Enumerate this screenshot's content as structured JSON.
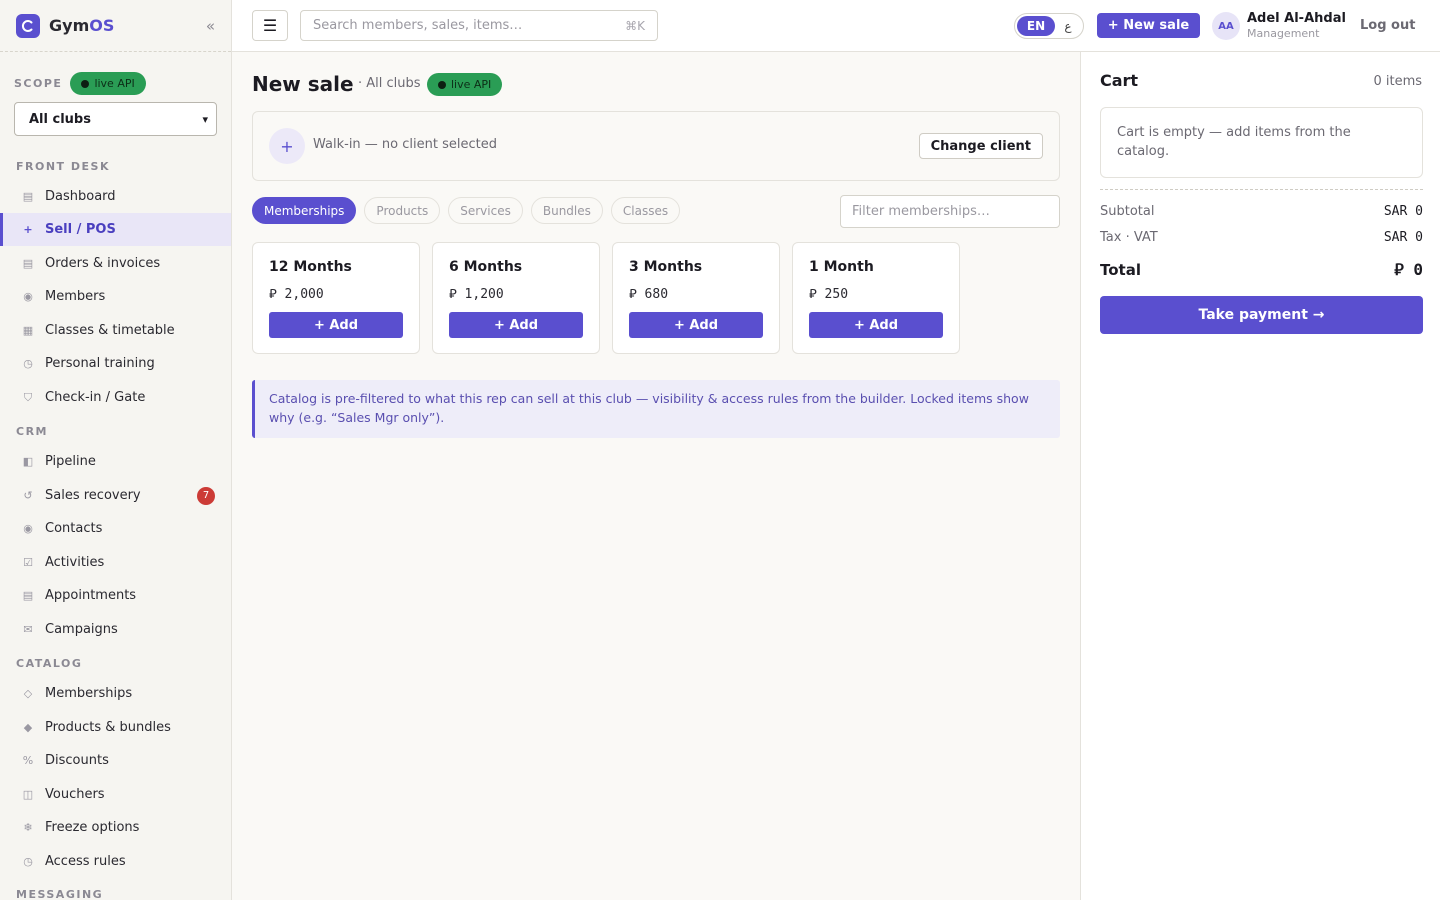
{
  "brand": {
    "name_main": "Gym",
    "name_accent": "OS",
    "collapse_icon": "«"
  },
  "scope": {
    "label": "SCOPE",
    "live_label": "live API",
    "club_selected": "All clubs"
  },
  "sidebar": {
    "sections": [
      {
        "label": "FRONT DESK",
        "items": [
          {
            "label": "Dashboard",
            "icon": "▤"
          },
          {
            "label": "Sell / POS",
            "icon": "+",
            "active": true
          },
          {
            "label": "Orders & invoices",
            "icon": "▤"
          },
          {
            "label": "Members",
            "icon": "◉"
          },
          {
            "label": "Classes & timetable",
            "icon": "▦"
          },
          {
            "label": "Personal training",
            "icon": "◷"
          },
          {
            "label": "Check-in / Gate",
            "icon": "⛉"
          }
        ]
      },
      {
        "label": "CRM",
        "items": [
          {
            "label": "Pipeline",
            "icon": "◧"
          },
          {
            "label": "Sales recovery",
            "icon": "↺",
            "badge": "7"
          },
          {
            "label": "Contacts",
            "icon": "◉"
          },
          {
            "label": "Activities",
            "icon": "☑"
          },
          {
            "label": "Appointments",
            "icon": "▤"
          },
          {
            "label": "Campaigns",
            "icon": "✉"
          }
        ]
      },
      {
        "label": "CATALOG",
        "items": [
          {
            "label": "Memberships",
            "icon": "◇"
          },
          {
            "label": "Products & bundles",
            "icon": "◆"
          },
          {
            "label": "Discounts",
            "icon": "%"
          },
          {
            "label": "Vouchers",
            "icon": "◫"
          },
          {
            "label": "Freeze options",
            "icon": "❄"
          },
          {
            "label": "Access rules",
            "icon": "◷"
          }
        ]
      },
      {
        "label": "MESSAGING",
        "items": []
      }
    ]
  },
  "topbar": {
    "menu_icon": "☰",
    "search_placeholder": "Search members, sales, items…",
    "search_shortcut": "⌘K",
    "lang_active": "EN",
    "lang_other": "ع",
    "new_sale_label": "+ New sale",
    "user_initials": "AA",
    "user_name": "Adel Al-Ahdal",
    "user_role": "Management",
    "logout_label": "Log out"
  },
  "main": {
    "title": "New sale",
    "subtitle": "· All clubs",
    "live_label": "live API",
    "client": {
      "plus": "+",
      "text": "Walk-in — no client selected",
      "change_label": "Change client"
    },
    "tabs": [
      {
        "label": "Memberships",
        "active": true
      },
      {
        "label": "Products"
      },
      {
        "label": "Services"
      },
      {
        "label": "Bundles"
      },
      {
        "label": "Classes"
      }
    ],
    "filter_placeholder": "Filter memberships…",
    "products": [
      {
        "name": "12 Months",
        "price": "⃁ 2,000",
        "add_label": "+ Add"
      },
      {
        "name": "6 Months",
        "price": "⃁ 1,200",
        "add_label": "+ Add"
      },
      {
        "name": "3 Months",
        "price": "⃁ 680",
        "add_label": "+ Add"
      },
      {
        "name": "1 Month",
        "price": "⃁ 250",
        "add_label": "+ Add"
      }
    ],
    "note": "Catalog is pre-filtered to what this rep can sell at this club — visibility & access rules from the builder. Locked items show why (e.g. “Sales Mgr only”)."
  },
  "cart": {
    "title": "Cart",
    "count": "0 items",
    "empty_text": "Cart is empty — add items from the catalog.",
    "subtotal_label": "Subtotal",
    "subtotal_value": "SAR 0",
    "tax_label": "Tax · VAT",
    "tax_value": "SAR 0",
    "total_label": "Total",
    "total_value": "⃁ 0",
    "pay_label": "Take payment →"
  },
  "colors": {
    "accent": "#5a4fcf",
    "live": "#2a9d55",
    "badge": "#cc3b36"
  }
}
